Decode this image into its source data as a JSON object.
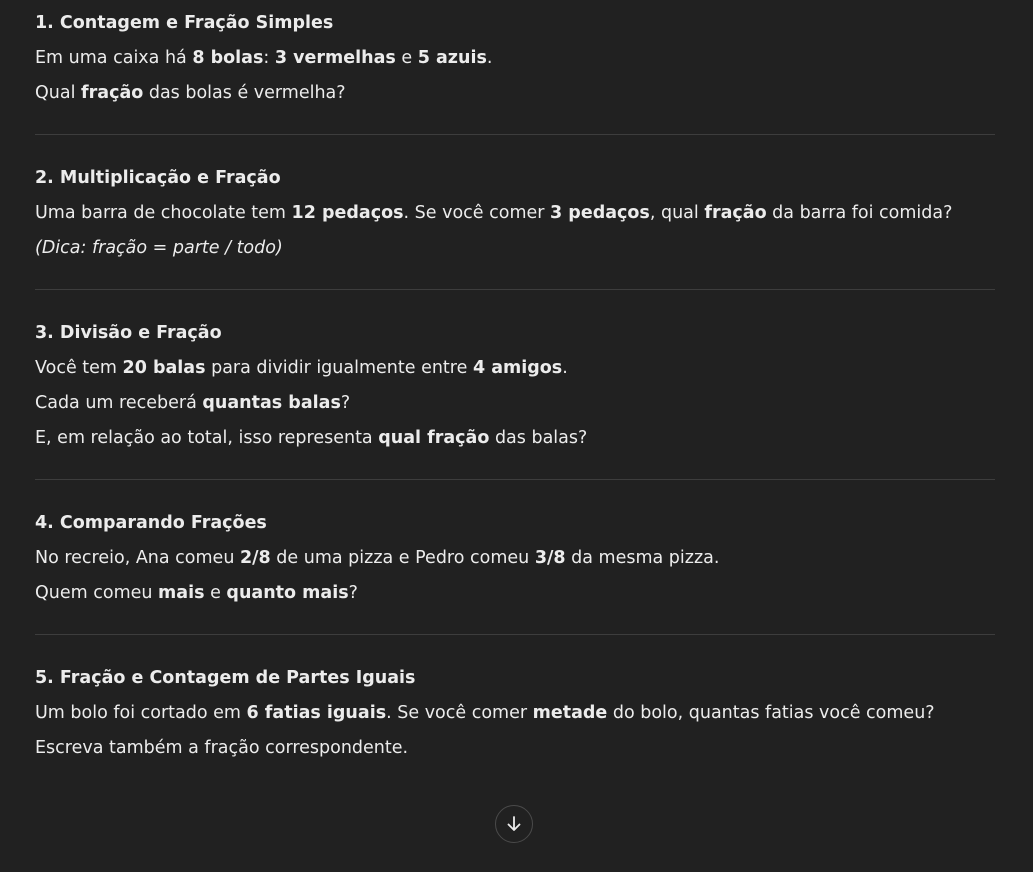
{
  "sections": [
    {
      "title": "1. Contagem e Fração Simples",
      "lines": [
        [
          {
            "t": "Em uma caixa há "
          },
          {
            "t": "8 bolas",
            "b": true
          },
          {
            "t": ": "
          },
          {
            "t": "3 vermelhas",
            "b": true
          },
          {
            "t": " e "
          },
          {
            "t": "5 azuis",
            "b": true
          },
          {
            "t": "."
          }
        ],
        [
          {
            "t": "Qual "
          },
          {
            "t": "fração",
            "b": true
          },
          {
            "t": " das bolas é vermelha?"
          }
        ]
      ]
    },
    {
      "title": "2. Multiplicação e Fração",
      "lines": [
        [
          {
            "t": "Uma barra de chocolate tem "
          },
          {
            "t": "12 pedaços",
            "b": true
          },
          {
            "t": ". Se você comer "
          },
          {
            "t": "3 pedaços",
            "b": true
          },
          {
            "t": ", qual "
          },
          {
            "t": "fração",
            "b": true
          },
          {
            "t": " da barra foi comida?"
          }
        ],
        [
          {
            "t": "(Dica: fração = parte / todo)",
            "i": true
          }
        ]
      ]
    },
    {
      "title": "3. Divisão e Fração",
      "lines": [
        [
          {
            "t": "Você tem "
          },
          {
            "t": "20 balas",
            "b": true
          },
          {
            "t": " para dividir igualmente entre "
          },
          {
            "t": "4 amigos",
            "b": true
          },
          {
            "t": "."
          }
        ],
        [
          {
            "t": "Cada um receberá "
          },
          {
            "t": "quantas balas",
            "b": true
          },
          {
            "t": "?"
          }
        ],
        [
          {
            "t": "E, em relação ao total, isso representa "
          },
          {
            "t": "qual fração",
            "b": true
          },
          {
            "t": " das balas?"
          }
        ]
      ]
    },
    {
      "title": "4. Comparando Frações",
      "lines": [
        [
          {
            "t": "No recreio, Ana comeu "
          },
          {
            "t": "2/8",
            "b": true
          },
          {
            "t": " de uma pizza e Pedro comeu "
          },
          {
            "t": "3/8",
            "b": true
          },
          {
            "t": " da mesma pizza."
          }
        ],
        [
          {
            "t": "Quem comeu "
          },
          {
            "t": "mais",
            "b": true
          },
          {
            "t": " e "
          },
          {
            "t": "quanto mais",
            "b": true
          },
          {
            "t": "?"
          }
        ]
      ]
    },
    {
      "title": "5. Fração e Contagem de Partes Iguais",
      "lines": [
        [
          {
            "t": "Um bolo foi cortado em "
          },
          {
            "t": "6 fatias iguais",
            "b": true
          },
          {
            "t": ". Se você comer "
          },
          {
            "t": "metade",
            "b": true
          },
          {
            "t": " do bolo, quantas fatias você comeu?"
          }
        ],
        [
          {
            "t": "Escreva também a fração correspondente."
          }
        ]
      ]
    }
  ],
  "scroll_button": {
    "icon": "arrow-down-icon"
  },
  "colors": {
    "background": "#212121",
    "text": "#ececec",
    "divider": "#3d3d3d"
  }
}
